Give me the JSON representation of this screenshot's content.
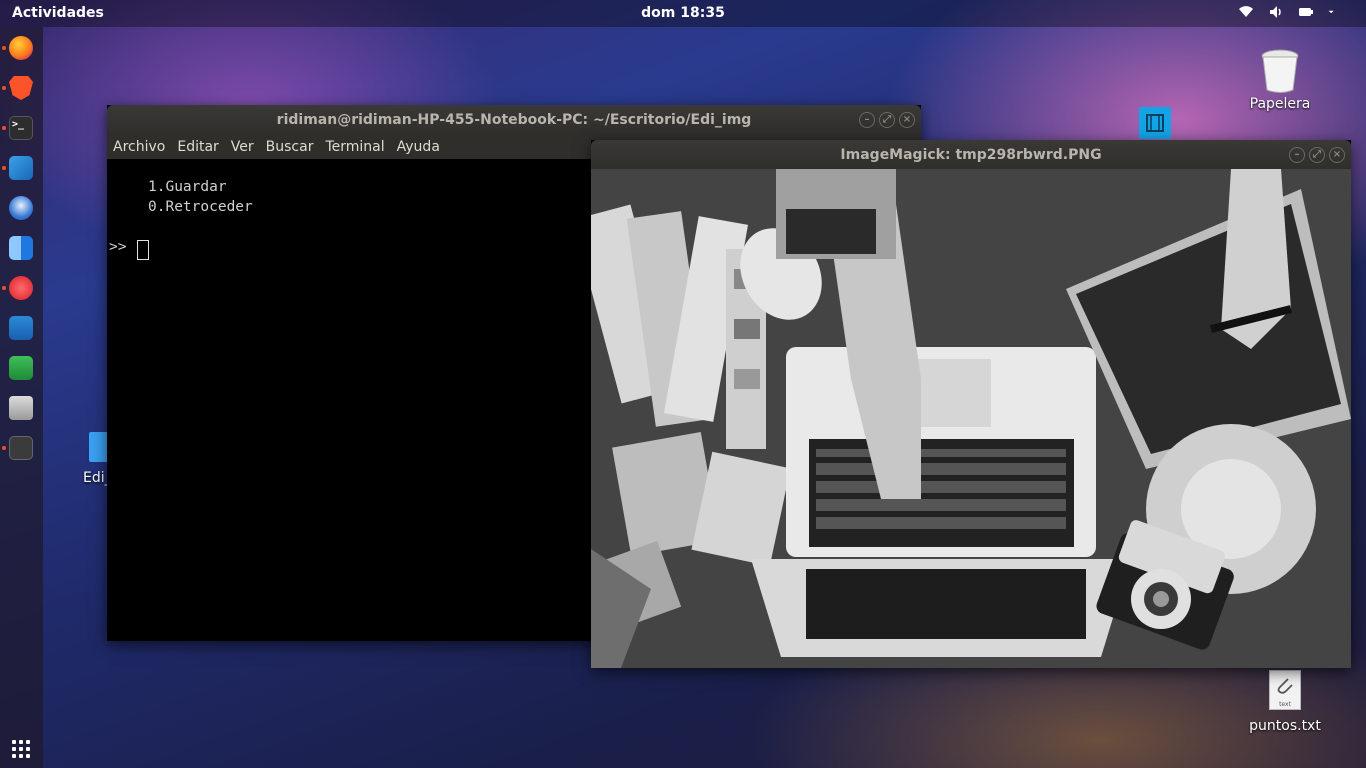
{
  "topbar": {
    "activities": "Actividades",
    "clock": "dom 18:35",
    "tray_icons": [
      "wifi-icon",
      "volume-icon",
      "battery-icon",
      "menu-arrow-icon"
    ]
  },
  "dock": {
    "items": [
      "firefox",
      "brave",
      "terminal",
      "vscode",
      "thunderbird",
      "finder",
      "music",
      "writer",
      "calc",
      "disks",
      "files"
    ],
    "show_apps": "apps-grid-icon"
  },
  "desktop": {
    "trash_label": "Papelera",
    "folder_label": "Edi_",
    "file_label": "puntos.txt",
    "file_type": "text"
  },
  "terminal": {
    "title": "ridiman@ridiman-HP-455-Notebook-PC: ~/Escritorio/Edi_img",
    "menu": [
      "Archivo",
      "Editar",
      "Ver",
      "Buscar",
      "Terminal",
      "Ayuda"
    ],
    "lines": [
      "1.Guardar",
      "0.Retroceder"
    ],
    "prompt": ">>"
  },
  "imagemagick": {
    "title": "ImageMagick: tmp298rbwrd.PNG"
  },
  "colors": {
    "accent": "#e95420",
    "titlebar": "#2f2e2b",
    "terminal_bg": "#000000"
  }
}
